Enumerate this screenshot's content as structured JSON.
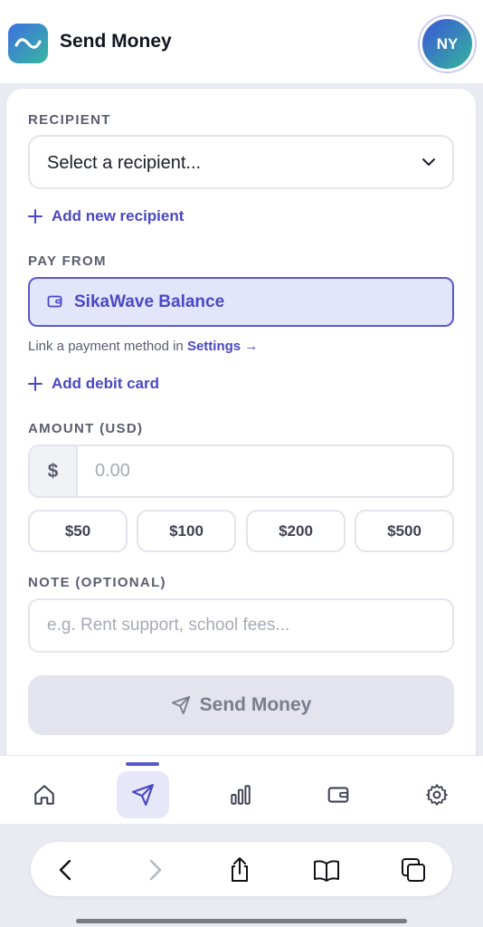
{
  "header": {
    "title": "Send Money",
    "avatar_initials": "NY"
  },
  "recipient": {
    "label": "RECIPIENT",
    "select_value": "Select a recipient...",
    "add_label": "Add new recipient"
  },
  "pay_from": {
    "label": "PAY FROM",
    "option": "SikaWave Balance",
    "hint_text": "Link a payment method in ",
    "hint_link": "Settings →",
    "add_card_label": "Add debit card"
  },
  "amount": {
    "label": "AMOUNT (USD)",
    "currency_symbol": "$",
    "placeholder": "0.00",
    "quick_amounts": [
      "$50",
      "$100",
      "$200",
      "$500"
    ]
  },
  "note": {
    "label": "NOTE (OPTIONAL)",
    "placeholder": "e.g. Rent support, school fees..."
  },
  "submit": {
    "label": "Send Money"
  },
  "nav": {
    "items": [
      "home-icon",
      "send-icon",
      "chart-icon",
      "wallet-icon",
      "settings-icon"
    ],
    "active_index": 1
  },
  "browser": {
    "icons": [
      "back-icon",
      "forward-icon",
      "share-icon",
      "bookmarks-icon",
      "tabs-icon"
    ]
  },
  "colors": {
    "accent": "#4a48c4",
    "accent_bg": "#e3e5fb",
    "disabled_button": "#e3e4ee"
  }
}
